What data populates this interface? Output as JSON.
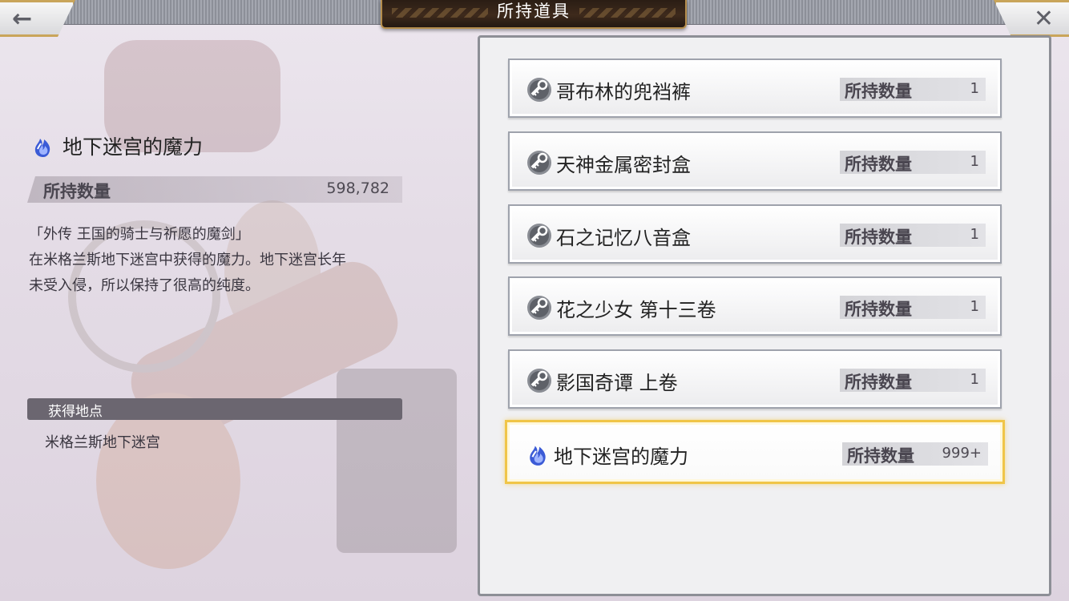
{
  "header": {
    "title": "所持道具"
  },
  "nav": {
    "back_glyph": "←",
    "close_glyph": "✕"
  },
  "detail": {
    "name": "地下迷宫的魔力",
    "icon": "blue-flame-icon",
    "qty_label": "所持数量",
    "qty_value": "598,782",
    "desc_lines": [
      "「外传 王国的骑士与祈愿的魔剑」",
      "在米格兰斯地下迷宫中获得的魔力。地下迷宫长年",
      "未受入侵，所以保持了很高的纯度。"
    ],
    "location_label": "获得地点",
    "location_value": "米格兰斯地下迷宫"
  },
  "items": [
    {
      "name": "哥布林的兜裆裤",
      "qty_label": "所持数量",
      "qty": "1",
      "icon": "key-item-icon"
    },
    {
      "name": "天神金属密封盒",
      "qty_label": "所持数量",
      "qty": "1",
      "icon": "key-item-icon"
    },
    {
      "name": "石之记忆八音盒",
      "qty_label": "所持数量",
      "qty": "1",
      "icon": "key-item-icon"
    },
    {
      "name": "花之少女 第十三卷",
      "qty_label": "所持数量",
      "qty": "1",
      "icon": "key-item-icon"
    },
    {
      "name": "影国奇谭 上卷",
      "qty_label": "所持数量",
      "qty": "1",
      "icon": "key-item-icon"
    },
    {
      "name": "地下迷宫的魔力",
      "qty_label": "所持数量",
      "qty": "999+",
      "icon": "blue-flame-icon"
    }
  ],
  "colors": {
    "accent_gold": "#f0c548",
    "flame_blue": "#3b5bd6",
    "title_plate": "#2a1d14"
  }
}
